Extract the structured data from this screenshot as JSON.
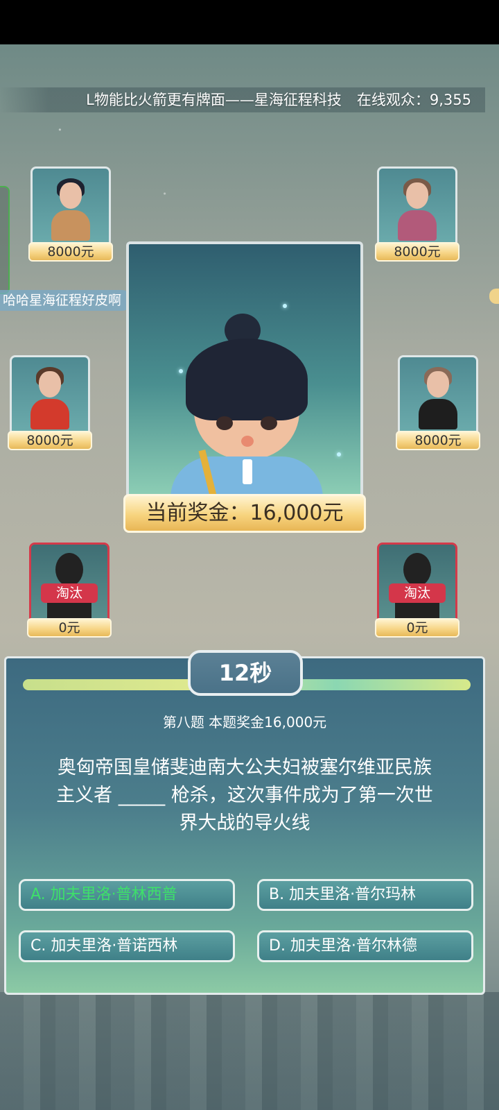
{
  "ticker": {
    "text": "L物能比火箭更有牌面——星海征程科技",
    "viewers": "在线观众：9,355"
  },
  "chat_bubble": "哈哈星海征程好皮啊",
  "contestants": {
    "top_left": {
      "prize": "8000元",
      "status": "active"
    },
    "top_right": {
      "prize": "8000元",
      "status": "active"
    },
    "mid_left": {
      "prize": "8000元",
      "status": "active"
    },
    "mid_right": {
      "prize": "8000元",
      "status": "active"
    },
    "bottom_left": {
      "prize": "0元",
      "tag": "淘汰",
      "status": "eliminated"
    },
    "bottom_right": {
      "prize": "0元",
      "tag": "淘汰",
      "status": "eliminated"
    }
  },
  "jackpot": "当前奖金：16,000元",
  "quiz": {
    "timer": "12秒",
    "title": "第八题 本题奖金16,000元",
    "question_line1": "奥匈帝国皇储斐迪南大公夫妇被塞尔维亚民族",
    "question_line2": "主义者 _____ 枪杀，这次事件成为了第一次世",
    "question_line3": "界大战的导火线",
    "options": [
      {
        "label": "A. 加夫里洛·普林西普",
        "highlight": "correct"
      },
      {
        "label": "B. 加夫里洛·普尔玛林"
      },
      {
        "label": "C. 加夫里洛·普诺西林"
      },
      {
        "label": "D. 加夫里洛·普尔林德"
      }
    ]
  },
  "colors": {
    "correct": "#3ee06a",
    "eliminated": "#d4364a",
    "gold": "#f6d382"
  }
}
